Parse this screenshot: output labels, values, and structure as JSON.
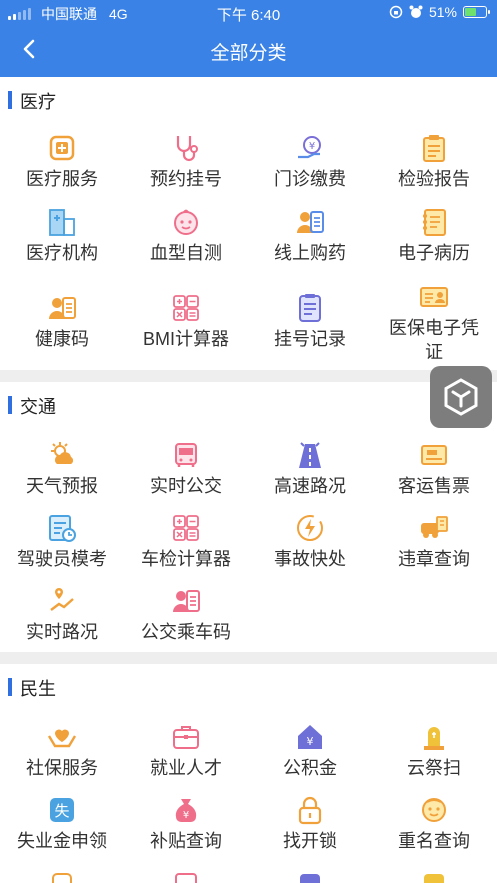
{
  "status": {
    "carrier": "中国联通",
    "network": "4G",
    "time": "下午 6:40",
    "battery": "51%",
    "battery_level": 0.51
  },
  "nav": {
    "back_icon": "chevron-left-icon",
    "title": "全部分类"
  },
  "colors": {
    "header": "#3a82e6",
    "accent_bar": "#2f6fe0",
    "icon_orange": "#f0a13a",
    "icon_blue": "#5a8de8",
    "icon_pink": "#ef6f8b",
    "icon_purple": "#7a6fd8"
  },
  "sections": [
    {
      "title": "医疗",
      "items": [
        {
          "label": "医疗服务",
          "icon": "medical-box-icon"
        },
        {
          "label": "预约挂号",
          "icon": "stethoscope-icon"
        },
        {
          "label": "门诊缴费",
          "icon": "payment-hand-icon"
        },
        {
          "label": "检验报告",
          "icon": "clipboard-icon"
        },
        {
          "label": "医疗机构",
          "icon": "hospital-building-icon"
        },
        {
          "label": "血型自测",
          "icon": "baby-face-icon"
        },
        {
          "label": "线上购药",
          "icon": "person-card-icon"
        },
        {
          "label": "电子病历",
          "icon": "record-book-icon"
        },
        {
          "label": "健康码",
          "icon": "person-card-icon"
        },
        {
          "label": "BMI计算器",
          "icon": "calculator-icon"
        },
        {
          "label": "挂号记录",
          "icon": "document-list-icon"
        },
        {
          "label": "医保电子凭证",
          "icon": "id-card-icon"
        }
      ]
    },
    {
      "title": "交通",
      "items": [
        {
          "label": "天气预报",
          "icon": "weather-sun-cloud-icon"
        },
        {
          "label": "实时公交",
          "icon": "bus-icon"
        },
        {
          "label": "高速路况",
          "icon": "highway-road-icon"
        },
        {
          "label": "客运售票",
          "icon": "ticket-icon"
        },
        {
          "label": "驾驶员模考",
          "icon": "exam-clipboard-icon"
        },
        {
          "label": "车检计算器",
          "icon": "calculator-icon"
        },
        {
          "label": "事故快处",
          "icon": "lightning-circle-icon"
        },
        {
          "label": "违章查询",
          "icon": "car-violation-icon"
        },
        {
          "label": "实时路况",
          "icon": "route-pin-icon"
        },
        {
          "label": "公交乘车码",
          "icon": "person-card-icon"
        }
      ]
    },
    {
      "title": "民生",
      "items": [
        {
          "label": "社保服务",
          "icon": "heart-hands-icon"
        },
        {
          "label": "就业人才",
          "icon": "briefcase-icon"
        },
        {
          "label": "公积金",
          "icon": "house-yuan-icon"
        },
        {
          "label": "云祭扫",
          "icon": "tombstone-icon"
        },
        {
          "label": "失业金申领",
          "icon": "unemployment-badge-icon"
        },
        {
          "label": "补贴查询",
          "icon": "money-bag-icon"
        },
        {
          "label": "找开锁",
          "icon": "padlock-icon"
        },
        {
          "label": "重名查询",
          "icon": "child-face-icon"
        }
      ]
    }
  ]
}
